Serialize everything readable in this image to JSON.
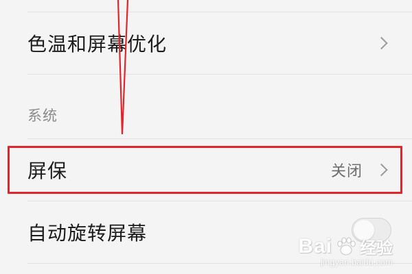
{
  "settings": {
    "color_temp_label": "色温和屏幕优化",
    "section_system": "系统",
    "screensaver_label": "屏保",
    "screensaver_value": "关闭",
    "auto_rotate_label": "自动旋转屏幕",
    "auto_rotate_enabled": false
  },
  "annotation": {
    "color": "#e0262c"
  },
  "watermark": {
    "brand": "Bai",
    "suffix": "经验",
    "url": "jingyan.baidu.com"
  },
  "colors": {
    "background": "#f4f4f4",
    "primary_text": "#1c1c1c",
    "secondary_text": "#8a8a8a",
    "highlight": "#e0262c"
  }
}
